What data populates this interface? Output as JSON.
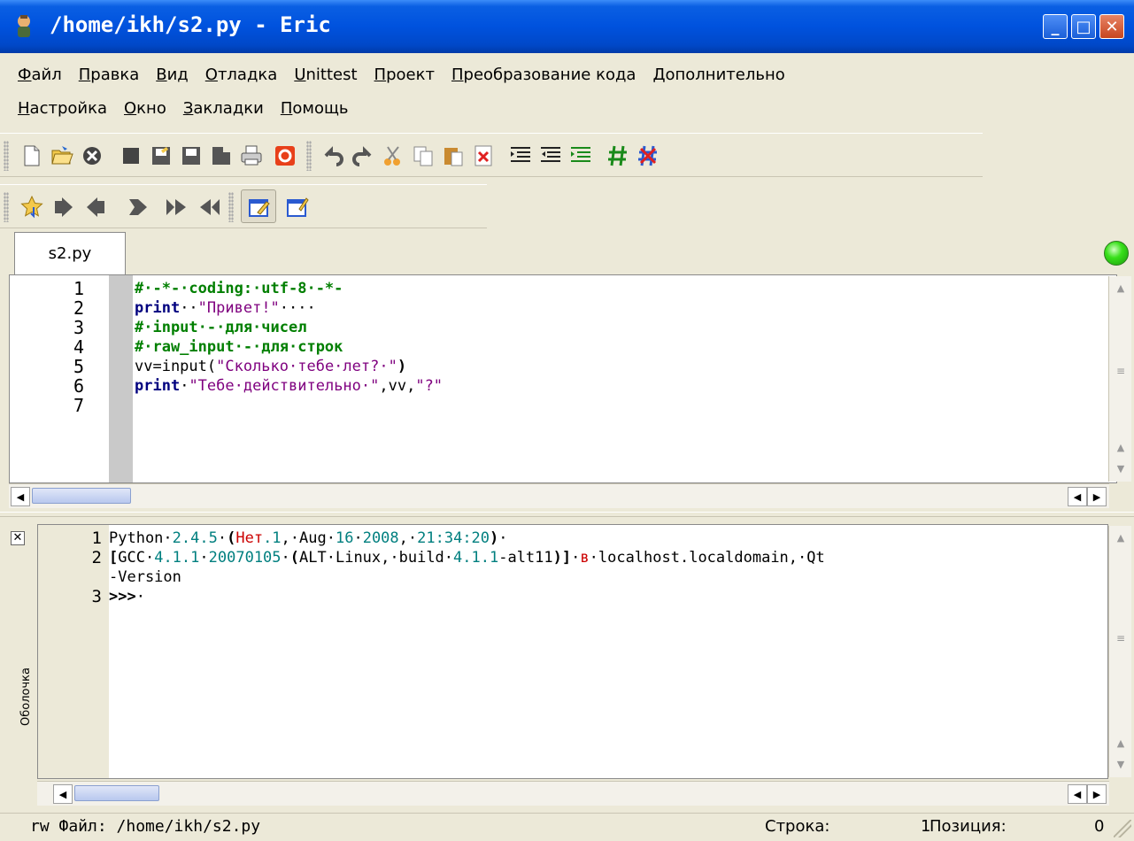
{
  "window": {
    "title": "/home/ikh/s2.py - Eric",
    "minimize_label": "_",
    "maximize_label": "□",
    "close_label": "✕"
  },
  "menu": {
    "row1": [
      "Файл",
      "Правка",
      "Вид",
      "Отладка",
      "Unittest",
      "Проект",
      "Преобразование кода",
      "Дополнительно"
    ],
    "row2": [
      "Настройка",
      "Окно",
      "Закладки",
      "Помощь"
    ]
  },
  "tabs": [
    {
      "label": "s2.py"
    }
  ],
  "editor": {
    "line_numbers": [
      "1",
      "2",
      "3",
      "4",
      "5",
      "6",
      "7"
    ],
    "l1_comment": "#·-*-·coding:·utf-8·-*-",
    "l2_kw": "print",
    "l2_sp": "··",
    "l2_str": "\"Привет!\"",
    "l2_tail": "····",
    "l3_comment": "#·input·-·для·чисел",
    "l4_comment": "#·raw_input·-·для·строк",
    "l5_pre": "vv=input(",
    "l5_str": "\"Сколько·тебе·лет?·\"",
    "l5_post": ")",
    "l6_kw": "print",
    "l6_sp": "·",
    "l6_str": "\"Тебе·действительно·\"",
    "l6_mid": ",vv,",
    "l6_str2": "\"?\""
  },
  "shell": {
    "tab_label": "Оболочка",
    "line_numbers": [
      "1",
      "2",
      "",
      "3"
    ],
    "l1_a": "Python·",
    "l1_b": "2.4.5",
    "l1_c": "·",
    "l1_d": "(",
    "l1_e": "Нет",
    "l1_f": ".1",
    "l1_g": ",·Aug·",
    "l1_h": "16",
    "l1_i": "·",
    "l1_j": "2008",
    "l1_k": ",·",
    "l1_l": "21:34:20",
    "l1_m": ")",
    "l1_n": "·",
    "l2_a": "[",
    "l2_b": "GCC·",
    "l2_c": "4.1.1",
    "l2_d": "·",
    "l2_e": "20070105",
    "l2_f": "·",
    "l2_g": "(",
    "l2_h": "ALT·Linux,·build·",
    "l2_i": "4.1.1",
    "l2_j": "-alt11",
    "l2_k": ")]",
    "l2_l": "·",
    "l2_m": "в",
    "l2_n": "·localhost.localdomain,·Qt",
    "l2b": "-Version",
    "l3_prompt": ">>>",
    "l3_tail": "·"
  },
  "statusbar": {
    "file": "rw Файл: /home/ikh/s2.py",
    "line_label": "Строка:",
    "line_value": "1",
    "pos_label": "Позиция:",
    "pos_value": "0"
  },
  "colors": {
    "keyword": "#00007f",
    "comment": "#007f00",
    "string": "#7f007f",
    "number": "#007f7f",
    "status_led": "#38e01a"
  },
  "toolbar_icons": {
    "row1": [
      "new-file-icon",
      "open-file-icon",
      "close-file-icon",
      "close-all-icon",
      "save-icon",
      "save-as-icon",
      "save-all-icon",
      "print-icon",
      "print-preview-icon",
      "undo-icon",
      "redo-icon",
      "cut-icon",
      "copy-icon",
      "paste-icon",
      "clear-icon",
      "indent-icon",
      "unindent-icon",
      "smart-indent-icon",
      "comment-icon",
      "uncomment-icon"
    ],
    "row2": [
      "bookmark-toggle-icon",
      "bookmark-next-icon",
      "bookmark-prev-icon",
      "bookmark-clear-icon",
      "goto-next-icon",
      "goto-prev-icon",
      "autocomplete-icon",
      "calltip-icon"
    ]
  }
}
